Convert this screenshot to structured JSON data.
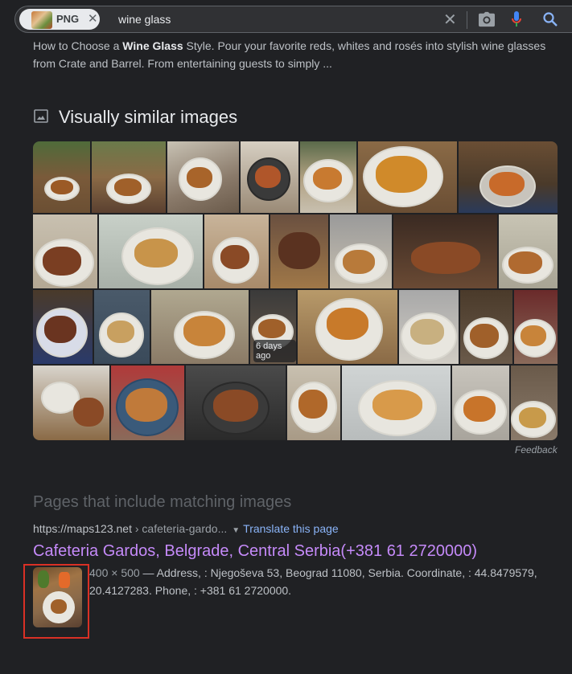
{
  "search": {
    "chip_label": "PNG",
    "query": "wine glass"
  },
  "top_snippet": {
    "part1": "How to Choose a ",
    "bold": "Wine Glass",
    "part2": " Style. Pour your favorite reds, whites and rosés into stylish wine glasses from Crate and Barrel. From entertaining guests to simply ..."
  },
  "visually_similar": {
    "title": "Visually similar images",
    "tile_badge": "6 days ago",
    "feedback": "Feedback",
    "colors": {
      "wood": "#8a6a46",
      "plate": "#e8e6df",
      "fried_food": "#a8642a",
      "dark_bg": "#3a3f4a"
    }
  },
  "matching_pages": {
    "title": "Pages that include matching images",
    "cite_domain": "https://maps123.net",
    "cite_path": " › cafeteria-gardo...",
    "translate": "Translate this page",
    "result_title": "Cafeteria Gardos, Belgrade, Central Serbia(+381 61 2720000)",
    "dimensions": "400 × 500",
    "description": " — Address, : Njegoševa 53, Beograd 11080, Serbia. Coordinate, : 44.8479579, 20.4127283. Phone, : +381 61 2720000."
  },
  "colors": {
    "background": "#202124",
    "link_visited": "#c58af9",
    "link": "#8ab4f8",
    "highlight_box": "#d93025",
    "mic_red": "#ea4335",
    "mic_blue": "#4285f4"
  }
}
